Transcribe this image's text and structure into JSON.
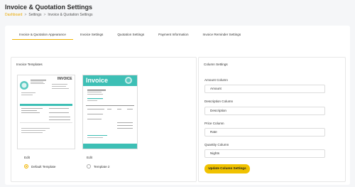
{
  "page": {
    "title": "Invoice & Quotation Settings",
    "breadcrumb": [
      "Dashboard",
      "Settings",
      "Invoice & Quotation Settings"
    ],
    "breadcrumb_sep": ">"
  },
  "tabs": [
    {
      "label": "Invoice & Quotation Appearance",
      "active": true
    },
    {
      "label": "Invoice Settings",
      "active": false
    },
    {
      "label": "Quotation Settings",
      "active": false
    },
    {
      "label": "Payment Information",
      "active": false
    },
    {
      "label": "Invoice Reminder Settings",
      "active": false
    }
  ],
  "templates_panel": {
    "title": "Invoice Templates",
    "templates": [
      {
        "edit_label": "Edit",
        "name": "Default Template",
        "selected": true,
        "thumb_heading": "INVOICE"
      },
      {
        "edit_label": "Edit",
        "name": "Template 2",
        "selected": false,
        "thumb_heading": "Invoice"
      }
    ]
  },
  "columns_panel": {
    "title": "Column Settings",
    "fields": [
      {
        "label": "Amount Column",
        "value": "Amount"
      },
      {
        "label": "Description Column",
        "value": "Description"
      },
      {
        "label": "Price Column",
        "value": "Rate"
      },
      {
        "label": "Quantity Column",
        "value": "Nights"
      }
    ],
    "button_label": "Update Column Settings"
  },
  "colors": {
    "accent": "#f0b400",
    "teal": "#3dbfb5",
    "button": "#f0c200"
  }
}
